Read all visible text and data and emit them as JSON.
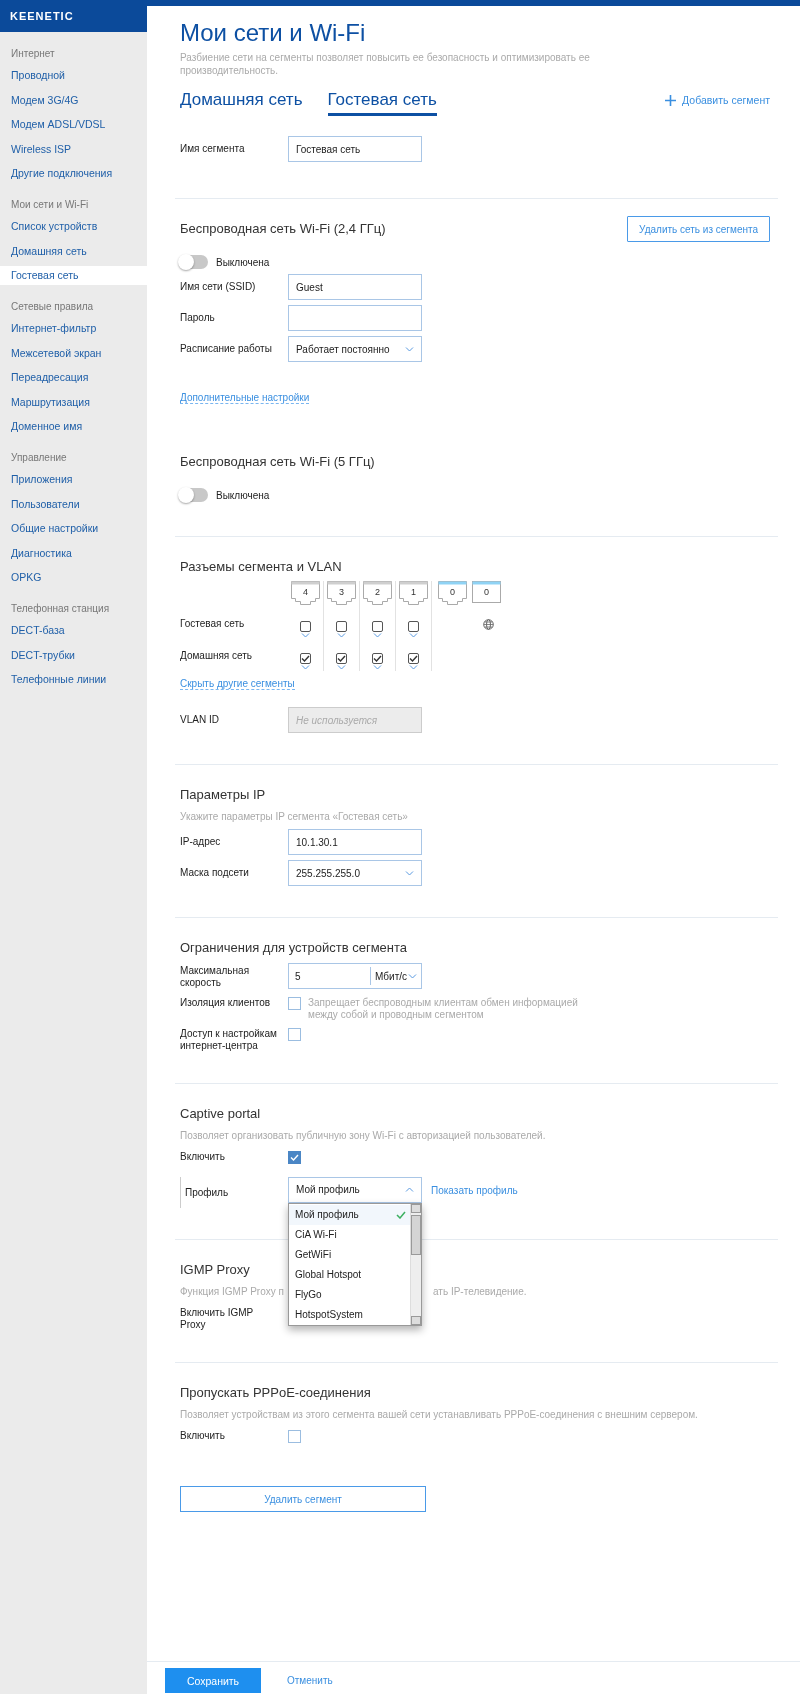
{
  "brand": {
    "logo": "KEENETIC"
  },
  "sidebar": {
    "groups": [
      {
        "title": "Интернет",
        "items": [
          {
            "label": "Проводной",
            "selected": false
          },
          {
            "label": "Модем 3G/4G",
            "selected": false
          },
          {
            "label": "Модем ADSL/VDSL",
            "selected": false
          },
          {
            "label": "Wireless ISP",
            "selected": false
          },
          {
            "label": "Другие подключения",
            "selected": false
          }
        ]
      },
      {
        "title": "Мои сети и Wi-Fi",
        "items": [
          {
            "label": "Список устройств",
            "selected": false
          },
          {
            "label": "Домашняя сеть",
            "selected": false
          },
          {
            "label": "Гостевая сеть",
            "selected": true
          }
        ]
      },
      {
        "title": "Сетевые правила",
        "items": [
          {
            "label": "Интернет-фильтр",
            "selected": false
          },
          {
            "label": "Межсетевой экран",
            "selected": false
          },
          {
            "label": "Переадресация",
            "selected": false
          },
          {
            "label": "Маршрутизация",
            "selected": false
          },
          {
            "label": "Доменное имя",
            "selected": false
          }
        ]
      },
      {
        "title": "Управление",
        "items": [
          {
            "label": "Приложения",
            "selected": false
          },
          {
            "label": "Пользователи",
            "selected": false
          },
          {
            "label": "Общие настройки",
            "selected": false
          },
          {
            "label": "Диагностика",
            "selected": false
          },
          {
            "label": "OPKG",
            "selected": false
          }
        ]
      },
      {
        "title": "Телефонная станция",
        "items": [
          {
            "label": "DECT-база",
            "selected": false
          },
          {
            "label": "DECT-трубки",
            "selected": false
          },
          {
            "label": "Телефонные линии",
            "selected": false
          }
        ]
      }
    ]
  },
  "page": {
    "title": "Мои сети и Wi-Fi",
    "description": "Разбиение сети на сегменты позволяет повысить ее безопасность и оптимизировать ее производительность."
  },
  "segment_tabs": [
    {
      "label": "Домашняя сеть",
      "selected": false
    },
    {
      "label": "Гостевая сеть",
      "selected": true
    }
  ],
  "add_segment": "Добавить сегмент",
  "sections": [
    {
      "rows": [
        {
          "kind": "input",
          "label": "Имя сегмента",
          "value": "Гостевая сеть"
        }
      ]
    },
    {
      "title": "Беспроводная сеть Wi-Fi (2,4 ГГц)",
      "action": "Удалить сеть из сегмента",
      "rows": [
        {
          "kind": "toggle",
          "label": "Выключена",
          "on": false
        },
        {
          "kind": "input",
          "label": "Имя сети (SSID)",
          "value": "Guest"
        },
        {
          "kind": "input",
          "label": "Пароль"
        },
        {
          "kind": "select",
          "label": "Расписание работы",
          "value": "Работает постоянно"
        },
        {
          "kind": "link",
          "label": "Дополнительные настройки"
        },
        {
          "kind": "subtitle",
          "text": "Беспроводная сеть Wi-Fi (5 ГГц)"
        },
        {
          "kind": "toggle",
          "label": "Выключена",
          "on": false
        }
      ]
    },
    {
      "title": "Разъемы сегмента и VLAN",
      "rows": [
        {
          "kind": "ports",
          "ports": [
            {
              "label": "4",
              "kind": "lan"
            },
            {
              "label": "3",
              "kind": "lan"
            },
            {
              "label": "2",
              "kind": "lan"
            },
            {
              "label": "1",
              "kind": "lan"
            },
            {
              "label": "0",
              "kind": "wan"
            },
            {
              "label": "0",
              "kind": "sfp"
            }
          ],
          "segments": [
            {
              "label": "Гостевая сеть",
              "internet": true,
              "cells": [
                {
                  "checked": false
                },
                {
                  "checked": false
                },
                {
                  "checked": false
                },
                {
                  "checked": false
                }
              ]
            },
            {
              "label": "Домашняя сеть",
              "internet": false,
              "cells": [
                {
                  "checked": true
                },
                {
                  "checked": true
                },
                {
                  "checked": true
                },
                {
                  "checked": true
                }
              ]
            }
          ]
        },
        {
          "kind": "link",
          "label": "Скрыть другие сегменты"
        },
        {
          "kind": "input",
          "label": "VLAN ID",
          "placeholder": "Не используется",
          "disabled": true
        }
      ]
    },
    {
      "title": "Параметры IP",
      "rows": [
        {
          "kind": "hint",
          "text": "Укажите параметры IP сегмента «Гостевая сеть»"
        },
        {
          "kind": "input",
          "label": "IP-адрес",
          "value": "10.1.30.1"
        },
        {
          "kind": "select",
          "label": "Маска подсети",
          "value": "255.255.255.0"
        }
      ]
    },
    {
      "title": "Ограничения для устройств сегмента",
      "rows": [
        {
          "kind": "speed",
          "label": "Максимальная скорость",
          "value": "5",
          "unit": "Мбит/с"
        },
        {
          "kind": "checkbox",
          "label": "Изоляция клиентов",
          "checked": false,
          "note": "Запрещает беспроводным клиентам обмен информацией между собой и проводным сегментом"
        },
        {
          "kind": "checkbox",
          "label": "Доступ к настройкам интернет-центра",
          "checked": false
        }
      ]
    },
    {
      "title": "Captive portal",
      "rows": [
        {
          "kind": "hint",
          "text": "Позволяет организовать публичную зону Wi-Fi с авторизацией пользователей."
        },
        {
          "kind": "checkbox",
          "label": "Включить",
          "checked": true
        },
        {
          "kind": "profile",
          "label": "Профиль",
          "value": "Мой профиль",
          "open": true,
          "link": "Показать профиль",
          "options": [
            {
              "label": "Мой профиль",
              "selected": true
            },
            {
              "label": "CiA Wi-Fi",
              "selected": false
            },
            {
              "label": "GetWiFi",
              "selected": false
            },
            {
              "label": "Global Hotspot",
              "selected": false
            },
            {
              "label": "FlyGo",
              "selected": false
            },
            {
              "label": "HotspotSystem",
              "selected": false
            }
          ]
        }
      ]
    },
    {
      "title": "IGMP Proxy",
      "rows": [
        {
          "kind": "hint_split",
          "parts": [
            "Функция IGMP Proxy п",
            "ать IP-телевидение."
          ]
        },
        {
          "kind": "label",
          "label": "Включить IGMP Proxy"
        }
      ]
    },
    {
      "title": "Пропускать PPPoE-соединения",
      "rows": [
        {
          "kind": "hint",
          "text": "Позволяет устройствам из этого сегмента вашей сети устанавливать PPPoE-соединения с внешним сервером."
        },
        {
          "kind": "checkbox",
          "label": "Включить",
          "checked": false
        }
      ]
    }
  ],
  "delete_segment": "Удалить сегмент",
  "footer": {
    "save": "Сохранить",
    "cancel": "Отменить"
  }
}
